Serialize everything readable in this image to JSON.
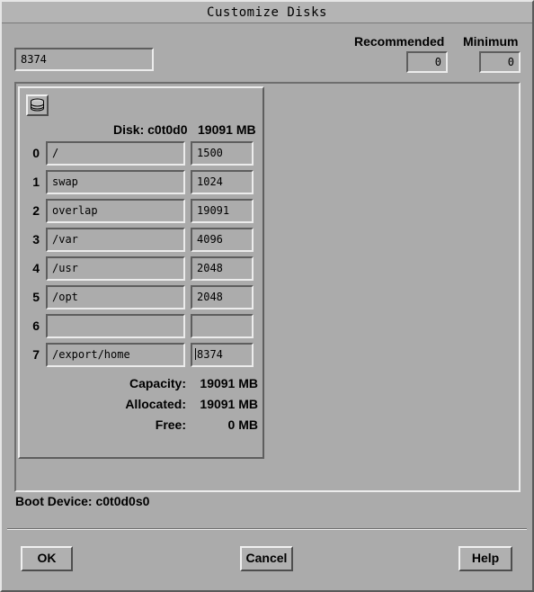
{
  "window": {
    "title": "Customize Disks"
  },
  "size_field": {
    "value": "8374"
  },
  "recommended": {
    "label": "Recommended",
    "value": "0"
  },
  "minimum": {
    "label": "Minimum",
    "value": "0"
  },
  "disk": {
    "header_label": "Disk: c0t0d0",
    "header_size": "19091 MB",
    "icon": "disk-icon",
    "slices": [
      {
        "num": "0",
        "mount": "/",
        "size": "1500"
      },
      {
        "num": "1",
        "mount": "swap",
        "size": "1024"
      },
      {
        "num": "2",
        "mount": "overlap",
        "size": "19091"
      },
      {
        "num": "3",
        "mount": "/var",
        "size": "4096"
      },
      {
        "num": "4",
        "mount": "/usr",
        "size": "2048"
      },
      {
        "num": "5",
        "mount": "/opt",
        "size": "2048"
      },
      {
        "num": "6",
        "mount": "",
        "size": ""
      },
      {
        "num": "7",
        "mount": "/export/home",
        "size": "8374"
      }
    ],
    "capacity": {
      "label": "Capacity:",
      "value": "19091 MB"
    },
    "allocated": {
      "label": "Allocated:",
      "value": "19091 MB"
    },
    "free": {
      "label": "Free:",
      "value": "0 MB"
    }
  },
  "boot_device": "Boot Device: c0t0d0s0",
  "buttons": {
    "ok": "OK",
    "cancel": "Cancel",
    "help": "Help"
  }
}
